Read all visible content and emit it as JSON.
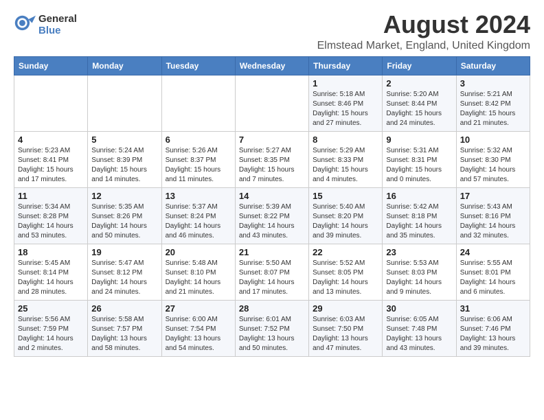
{
  "logo": {
    "general": "General",
    "blue": "Blue"
  },
  "title": "August 2024",
  "subtitle": "Elmstead Market, England, United Kingdom",
  "headers": [
    "Sunday",
    "Monday",
    "Tuesday",
    "Wednesday",
    "Thursday",
    "Friday",
    "Saturday"
  ],
  "weeks": [
    [
      {
        "day": "",
        "info": ""
      },
      {
        "day": "",
        "info": ""
      },
      {
        "day": "",
        "info": ""
      },
      {
        "day": "",
        "info": ""
      },
      {
        "day": "1",
        "info": "Sunrise: 5:18 AM\nSunset: 8:46 PM\nDaylight: 15 hours\nand 27 minutes."
      },
      {
        "day": "2",
        "info": "Sunrise: 5:20 AM\nSunset: 8:44 PM\nDaylight: 15 hours\nand 24 minutes."
      },
      {
        "day": "3",
        "info": "Sunrise: 5:21 AM\nSunset: 8:42 PM\nDaylight: 15 hours\nand 21 minutes."
      }
    ],
    [
      {
        "day": "4",
        "info": "Sunrise: 5:23 AM\nSunset: 8:41 PM\nDaylight: 15 hours\nand 17 minutes."
      },
      {
        "day": "5",
        "info": "Sunrise: 5:24 AM\nSunset: 8:39 PM\nDaylight: 15 hours\nand 14 minutes."
      },
      {
        "day": "6",
        "info": "Sunrise: 5:26 AM\nSunset: 8:37 PM\nDaylight: 15 hours\nand 11 minutes."
      },
      {
        "day": "7",
        "info": "Sunrise: 5:27 AM\nSunset: 8:35 PM\nDaylight: 15 hours\nand 7 minutes."
      },
      {
        "day": "8",
        "info": "Sunrise: 5:29 AM\nSunset: 8:33 PM\nDaylight: 15 hours\nand 4 minutes."
      },
      {
        "day": "9",
        "info": "Sunrise: 5:31 AM\nSunset: 8:31 PM\nDaylight: 15 hours\nand 0 minutes."
      },
      {
        "day": "10",
        "info": "Sunrise: 5:32 AM\nSunset: 8:30 PM\nDaylight: 14 hours\nand 57 minutes."
      }
    ],
    [
      {
        "day": "11",
        "info": "Sunrise: 5:34 AM\nSunset: 8:28 PM\nDaylight: 14 hours\nand 53 minutes."
      },
      {
        "day": "12",
        "info": "Sunrise: 5:35 AM\nSunset: 8:26 PM\nDaylight: 14 hours\nand 50 minutes."
      },
      {
        "day": "13",
        "info": "Sunrise: 5:37 AM\nSunset: 8:24 PM\nDaylight: 14 hours\nand 46 minutes."
      },
      {
        "day": "14",
        "info": "Sunrise: 5:39 AM\nSunset: 8:22 PM\nDaylight: 14 hours\nand 43 minutes."
      },
      {
        "day": "15",
        "info": "Sunrise: 5:40 AM\nSunset: 8:20 PM\nDaylight: 14 hours\nand 39 minutes."
      },
      {
        "day": "16",
        "info": "Sunrise: 5:42 AM\nSunset: 8:18 PM\nDaylight: 14 hours\nand 35 minutes."
      },
      {
        "day": "17",
        "info": "Sunrise: 5:43 AM\nSunset: 8:16 PM\nDaylight: 14 hours\nand 32 minutes."
      }
    ],
    [
      {
        "day": "18",
        "info": "Sunrise: 5:45 AM\nSunset: 8:14 PM\nDaylight: 14 hours\nand 28 minutes."
      },
      {
        "day": "19",
        "info": "Sunrise: 5:47 AM\nSunset: 8:12 PM\nDaylight: 14 hours\nand 24 minutes."
      },
      {
        "day": "20",
        "info": "Sunrise: 5:48 AM\nSunset: 8:10 PM\nDaylight: 14 hours\nand 21 minutes."
      },
      {
        "day": "21",
        "info": "Sunrise: 5:50 AM\nSunset: 8:07 PM\nDaylight: 14 hours\nand 17 minutes."
      },
      {
        "day": "22",
        "info": "Sunrise: 5:52 AM\nSunset: 8:05 PM\nDaylight: 14 hours\nand 13 minutes."
      },
      {
        "day": "23",
        "info": "Sunrise: 5:53 AM\nSunset: 8:03 PM\nDaylight: 14 hours\nand 9 minutes."
      },
      {
        "day": "24",
        "info": "Sunrise: 5:55 AM\nSunset: 8:01 PM\nDaylight: 14 hours\nand 6 minutes."
      }
    ],
    [
      {
        "day": "25",
        "info": "Sunrise: 5:56 AM\nSunset: 7:59 PM\nDaylight: 14 hours\nand 2 minutes."
      },
      {
        "day": "26",
        "info": "Sunrise: 5:58 AM\nSunset: 7:57 PM\nDaylight: 13 hours\nand 58 minutes."
      },
      {
        "day": "27",
        "info": "Sunrise: 6:00 AM\nSunset: 7:54 PM\nDaylight: 13 hours\nand 54 minutes."
      },
      {
        "day": "28",
        "info": "Sunrise: 6:01 AM\nSunset: 7:52 PM\nDaylight: 13 hours\nand 50 minutes."
      },
      {
        "day": "29",
        "info": "Sunrise: 6:03 AM\nSunset: 7:50 PM\nDaylight: 13 hours\nand 47 minutes."
      },
      {
        "day": "30",
        "info": "Sunrise: 6:05 AM\nSunset: 7:48 PM\nDaylight: 13 hours\nand 43 minutes."
      },
      {
        "day": "31",
        "info": "Sunrise: 6:06 AM\nSunset: 7:46 PM\nDaylight: 13 hours\nand 39 minutes."
      }
    ]
  ]
}
